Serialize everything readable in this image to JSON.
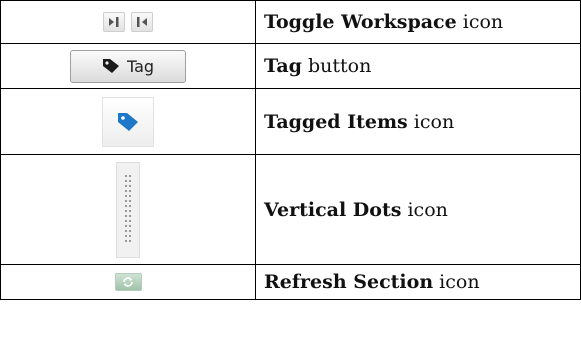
{
  "rows": [
    {
      "icon": "toggle-workspace-icons",
      "label_bold": "Toggle Workspace",
      "label_rest": " icon"
    },
    {
      "icon": "tag-button",
      "button_label": "Tag",
      "label_bold": "Tag",
      "label_rest": " button"
    },
    {
      "icon": "tagged-items-icon",
      "label_bold": "Tagged Items",
      "label_rest": " icon"
    },
    {
      "icon": "vertical-dots-icon",
      "label_bold": "Vertical Dots",
      "label_rest": " icon"
    },
    {
      "icon": "refresh-section-icon",
      "label_bold": "Refresh Section",
      "label_rest": " icon"
    }
  ],
  "colors": {
    "tag_blue": "#1f77c8",
    "refresh_green": "#a9c9b2",
    "border": "#000000"
  }
}
